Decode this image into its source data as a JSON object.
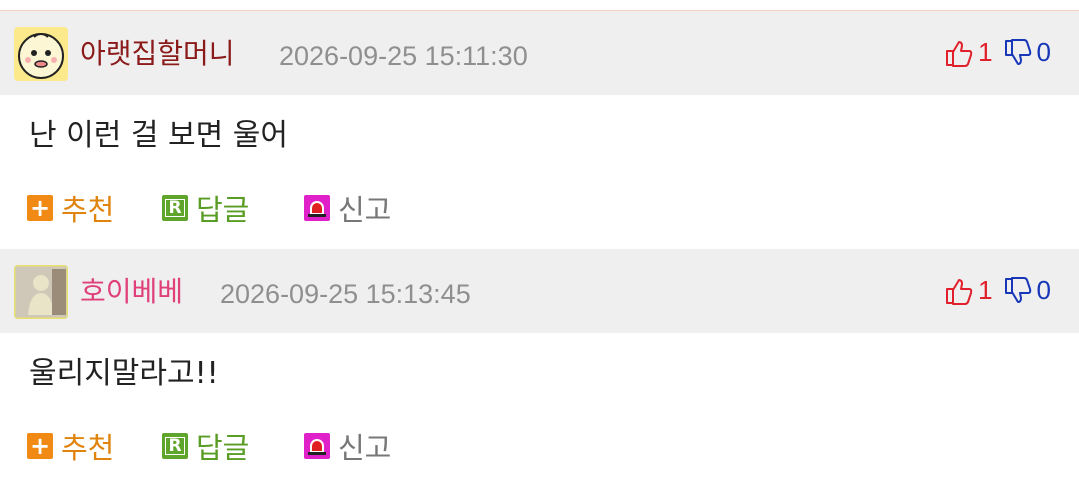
{
  "comments": [
    {
      "nick": "아랫집할머니",
      "nick_color": "#8b1a1a",
      "date": "2026-09-25 15:11:30",
      "up": "1",
      "down": "0",
      "text": "난 이런 걸 보면 울어",
      "actions": {
        "recommend": "추천",
        "reply": "답글",
        "report": "신고"
      }
    },
    {
      "nick": "호이베베",
      "nick_color": "#e0407a",
      "date": "2026-09-25 15:13:45",
      "up": "1",
      "down": "0",
      "text": "울리지말라고!!",
      "actions": {
        "recommend": "추천",
        "reply": "답글",
        "report": "신고"
      }
    }
  ],
  "icons": {
    "recommend": "plus-icon",
    "reply": "reply-r-icon",
    "report": "siren-icon",
    "up": "thumbs-up-icon",
    "down": "thumbs-down-icon"
  },
  "colors": {
    "up": "#e0202a",
    "down": "#1836b8",
    "recommend": "#f08a14",
    "reply": "#5fa52c",
    "report": "#e020c8"
  }
}
